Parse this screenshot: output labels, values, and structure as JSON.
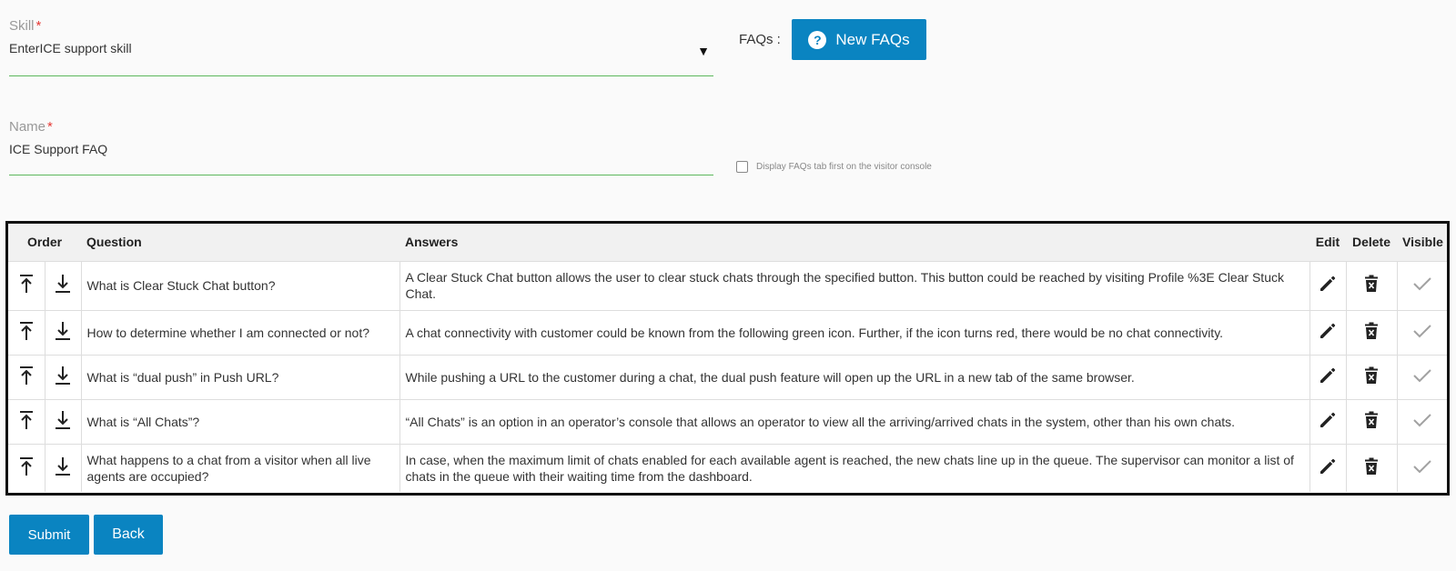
{
  "form": {
    "skill": {
      "label": "Skill",
      "required_mark": "*",
      "value": "EnterICE support skill",
      "arrow": "▼"
    },
    "name": {
      "label": "Name",
      "required_mark": "*",
      "value": "ICE Support FAQ"
    },
    "faqs_label": "FAQs :",
    "new_faqs_button": "New FAQs",
    "new_faqs_icon": "?",
    "display_first_checkbox": {
      "label": "Display FAQs tab first on the visitor console",
      "checked": false
    }
  },
  "table": {
    "headers": {
      "order": "Order",
      "question": "Question",
      "answers": "Answers",
      "edit": "Edit",
      "delete": "Delete",
      "visible": "Visible"
    },
    "rows": [
      {
        "question": "What is Clear Stuck Chat button?",
        "answer": "A Clear Stuck Chat button allows the user to clear stuck chats through the specified button. This button could be reached by visiting Profile %3E Clear Stuck Chat."
      },
      {
        "question": "How to determine whether I am connected or not?",
        "answer": "A chat connectivity with customer could be known from the following green icon. Further, if the icon turns red, there would be no chat connectivity."
      },
      {
        "question": "What is “dual push” in Push URL?",
        "answer": "While pushing a URL to the customer during a chat, the dual push feature will open up the URL in a new tab of the same browser."
      },
      {
        "question": "What is “All Chats”?",
        "answer": "“All Chats” is an option in an operator’s console that allows an operator to view all the arriving/arrived chats in the system, other than his own chats."
      },
      {
        "question": "What happens to a chat from a visitor when all live agents are occupied?",
        "answer": "In case, when the maximum limit of chats enabled for each available agent is reached, the new chats line up in the queue. The supervisor can monitor a list of chats in the queue with their waiting time from the dashboard."
      }
    ]
  },
  "footer": {
    "submit_button": "Submit",
    "back_button": "Back"
  },
  "colors": {
    "primary": "#0a84c1",
    "field_underline": "#5cb85c",
    "required": "#e53935"
  },
  "icons": {
    "move_top": "move-to-top-icon",
    "move_bottom": "move-to-bottom-icon",
    "edit": "pencil-icon",
    "delete": "trash-icon",
    "visible": "check-icon"
  }
}
